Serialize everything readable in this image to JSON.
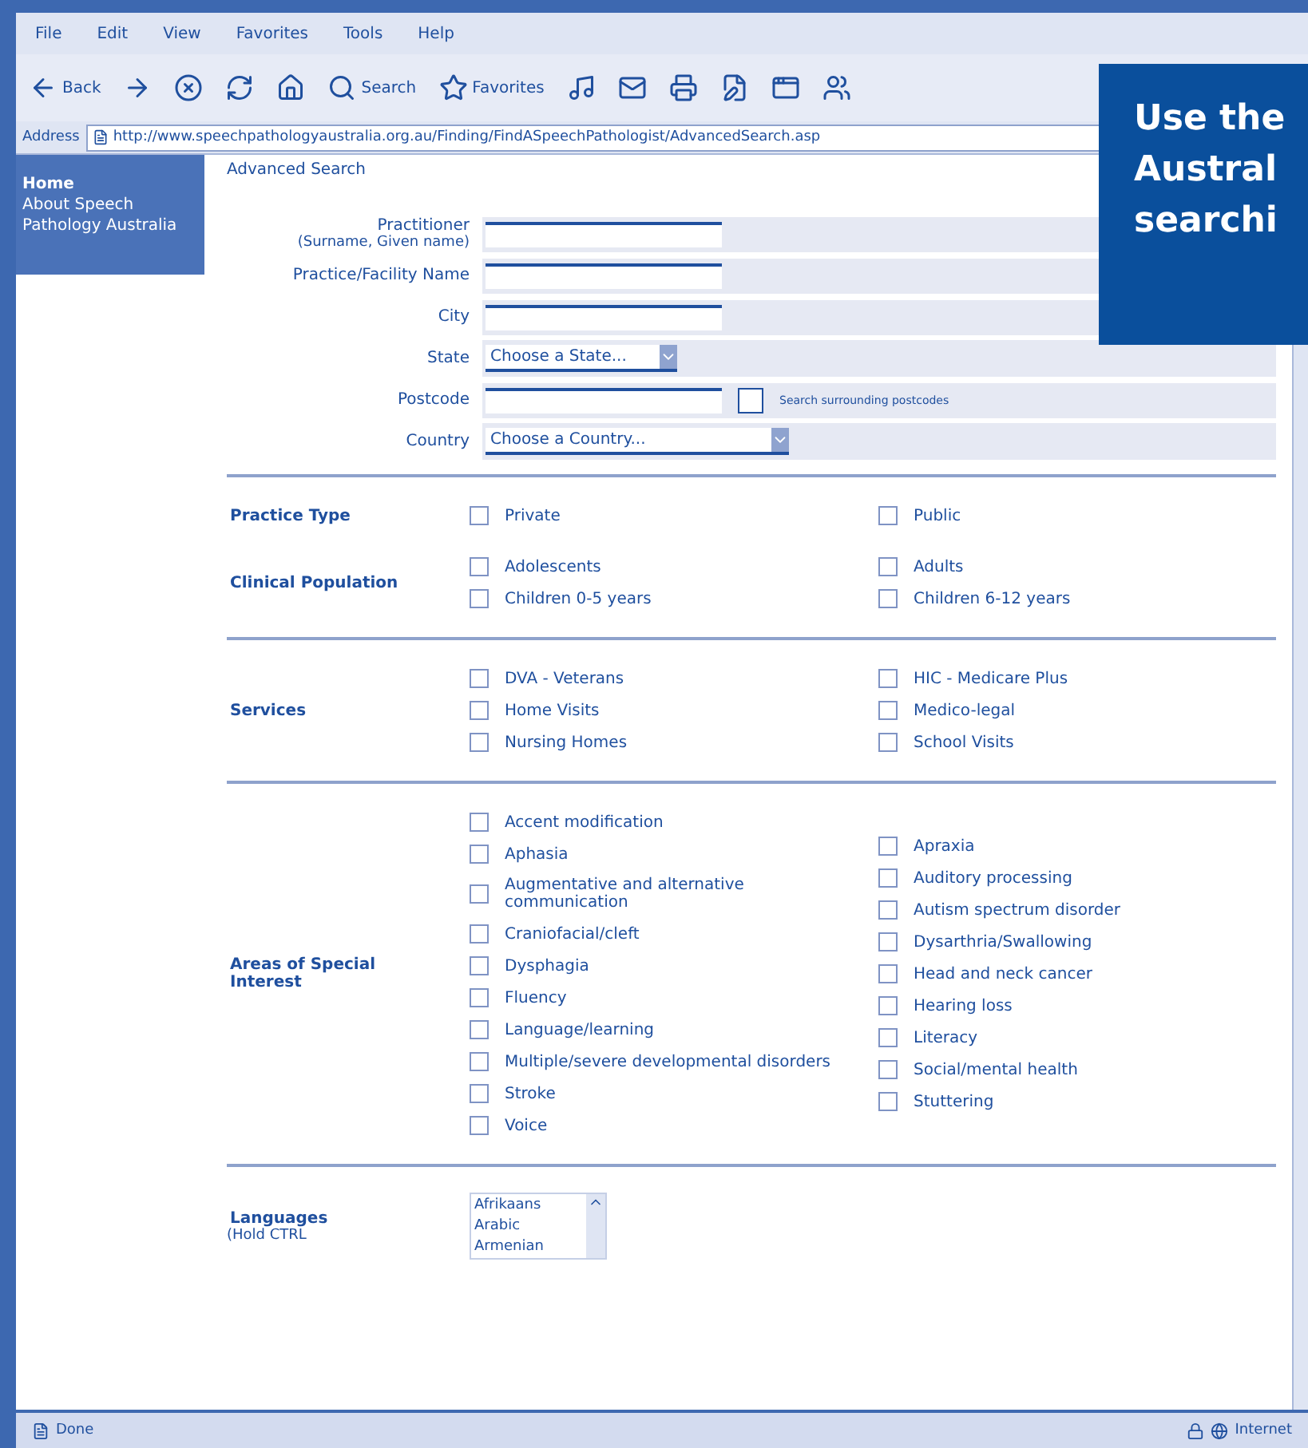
{
  "browser": {
    "menu": [
      "File",
      "Edit",
      "View",
      "Favorites",
      "Tools",
      "Help"
    ],
    "toolbar": [
      {
        "kind": "back",
        "label": "Back"
      },
      {
        "kind": "forward"
      },
      {
        "kind": "stop"
      },
      {
        "kind": "refresh"
      },
      {
        "kind": "home"
      },
      {
        "kind": "search",
        "label": "Search"
      },
      {
        "kind": "favorites",
        "label": "Favorites"
      },
      {
        "kind": "media"
      },
      {
        "kind": "mail"
      },
      {
        "kind": "print"
      },
      {
        "kind": "edit"
      },
      {
        "kind": "window"
      },
      {
        "kind": "discuss"
      }
    ],
    "address_label": "Address",
    "url": "http://www.speechpathologyaustralia.org.au/Finding/FindASpeechPathologist/AdvancedSearch.asp"
  },
  "sidebar": {
    "items": [
      "Home",
      "About Speech",
      "Pathology Australia"
    ]
  },
  "page": {
    "title": "Advanced Search",
    "fields": [
      {
        "kind": "text",
        "label": "Practitioner",
        "sublabel": "(Surname, Given name)"
      },
      {
        "kind": "text",
        "label": "Practice/Facility Name"
      },
      {
        "kind": "text",
        "label": "City"
      },
      {
        "kind": "select",
        "label": "State",
        "value": "Choose a State..."
      },
      {
        "kind": "postcode",
        "label": "Postcode",
        "note": "Search surrounding postcodes"
      },
      {
        "kind": "select",
        "label": "Country",
        "value": "Choose a Country..."
      }
    ],
    "sections": [
      {
        "title": "Practice Type",
        "columns": [
          [
            {
              "label": "Private",
              "checked": false
            }
          ],
          [
            {
              "label": "Public",
              "checked": false
            }
          ]
        ]
      },
      {
        "title": "Clinical Population",
        "columns": [
          [
            {
              "label": "Adolescents",
              "checked": false
            },
            {
              "label": "Children 0-5 years",
              "checked": false
            }
          ],
          [
            {
              "label": "Adults",
              "checked": false
            },
            {
              "label": "Children 6-12 years",
              "checked": false
            }
          ]
        ]
      },
      {
        "title": "Services",
        "columns": [
          [
            {
              "label": "DVA - Veterans",
              "checked": false
            },
            {
              "label": "Home Visits",
              "checked": false
            },
            {
              "label": "Nursing Homes",
              "checked": false
            }
          ],
          [
            {
              "label": "HIC - Medicare Plus",
              "checked": false
            },
            {
              "label": "Medico-legal",
              "checked": false
            },
            {
              "label": "School Visits",
              "checked": false
            }
          ]
        ]
      },
      {
        "title": "Areas of Special Interest",
        "columns": [
          [
            {
              "label": "Accent modification",
              "checked": false
            },
            {
              "label": "Aphasia",
              "checked": false
            },
            {
              "label": "Augmentative and alternative communication",
              "checked": false
            },
            {
              "label": "Craniofacial/cleft",
              "checked": false
            },
            {
              "label": "Dysphagia",
              "checked": false
            },
            {
              "label": "Fluency",
              "checked": false
            },
            {
              "label": "Language/learning",
              "checked": false
            },
            {
              "label": "Multiple/severe developmental disorders",
              "checked": false
            },
            {
              "label": "Stroke",
              "checked": false
            },
            {
              "label": "Voice",
              "checked": false
            }
          ],
          [
            {
              "label": "Apraxia",
              "checked": false
            },
            {
              "label": "Auditory processing",
              "checked": false
            },
            {
              "label": "Autism spectrum disorder",
              "checked": false
            },
            {
              "label": "Dysarthria/Swallowing",
              "checked": false
            },
            {
              "label": "Head and neck cancer",
              "checked": false
            },
            {
              "label": "Hearing loss",
              "checked": false
            },
            {
              "label": "Literacy",
              "checked": false
            },
            {
              "label": "Social/mental health",
              "checked": false
            },
            {
              "label": "Stuttering",
              "checked": false
            }
          ]
        ]
      }
    ],
    "languages": {
      "title": "Languages",
      "note": "(Hold CTRL",
      "options": [
        "Afrikaans",
        "Arabic",
        "Armenian"
      ]
    }
  },
  "status_bar": {
    "text": "Done",
    "zone": "Internet"
  },
  "callout": {
    "lines": [
      "Use the",
      "Austral",
      "searchi"
    ]
  }
}
